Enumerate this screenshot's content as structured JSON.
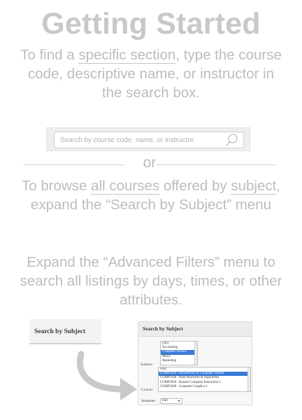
{
  "page": {
    "title": "Getting Started"
  },
  "intro": {
    "p1_prefix": "To find a ",
    "p1_link": "specific section",
    "p1_suffix": ", type the course code, descriptive name, or instructor in the search box."
  },
  "search": {
    "placeholder": "Search by course code, name, or instructor.",
    "icon": "search-icon"
  },
  "divider": {
    "label": "or"
  },
  "browse": {
    "pre": "To browse ",
    "link1": "all courses",
    "mid": " offered by ",
    "link2": "subject",
    "post": ", expand the “Search by Subject” menu"
  },
  "advanced": {
    "text": "Expand the “Advanced Filters” menu to search all listings by days, times, or other attributes."
  },
  "collapsed_panel": {
    "label": "Search by Subject"
  },
  "expanded_panel": {
    "header": "Search by Subject",
    "subject_label": "Subject:",
    "subjects": [
      "(All)",
      "Accounting",
      "Computer Science",
      "Music",
      "Marketing"
    ],
    "selected_subject": "Computer Science",
    "course_label": "Course:",
    "courses": [
      "(All)",
      "COMP1010 : Introduction to Computer Science",
      "COMP2140 : Data Structures & Algorithms",
      "COMP3020 : Human Computer Interaction I",
      "COMP3490 : Computer Graphics I"
    ],
    "selected_course": "COMP1010 : Introduction to Computer Science",
    "semester_label": "Semester",
    "semester_value": "Fall"
  },
  "colors": {
    "text_grey": "#bdbdbd",
    "title_grey": "#c8c8c8",
    "selection_blue": "#3a7bd5"
  }
}
